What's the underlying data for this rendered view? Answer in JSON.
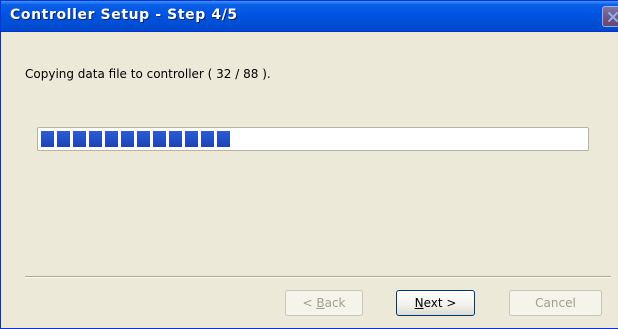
{
  "window": {
    "title": "Controller Setup - Step 4/5"
  },
  "content": {
    "message": "Copying data file to controller ( 32 / 88 )."
  },
  "progress": {
    "current": 32,
    "total": 88,
    "fraction": 0.36,
    "bar_color": "#2350c8"
  },
  "buttons": {
    "back": {
      "label_mnemonic": "B",
      "label_rest": "ack",
      "prefix": "< ",
      "enabled": false
    },
    "next": {
      "label_mnemonic": "N",
      "label_rest": "ext",
      "suffix": " >",
      "enabled": true
    },
    "cancel": {
      "label": "Cancel",
      "enabled": false
    }
  },
  "icons": {
    "close": "close-icon"
  },
  "colors": {
    "titlebar": "#0054e3",
    "dialog_bg": "#ece9d8"
  }
}
